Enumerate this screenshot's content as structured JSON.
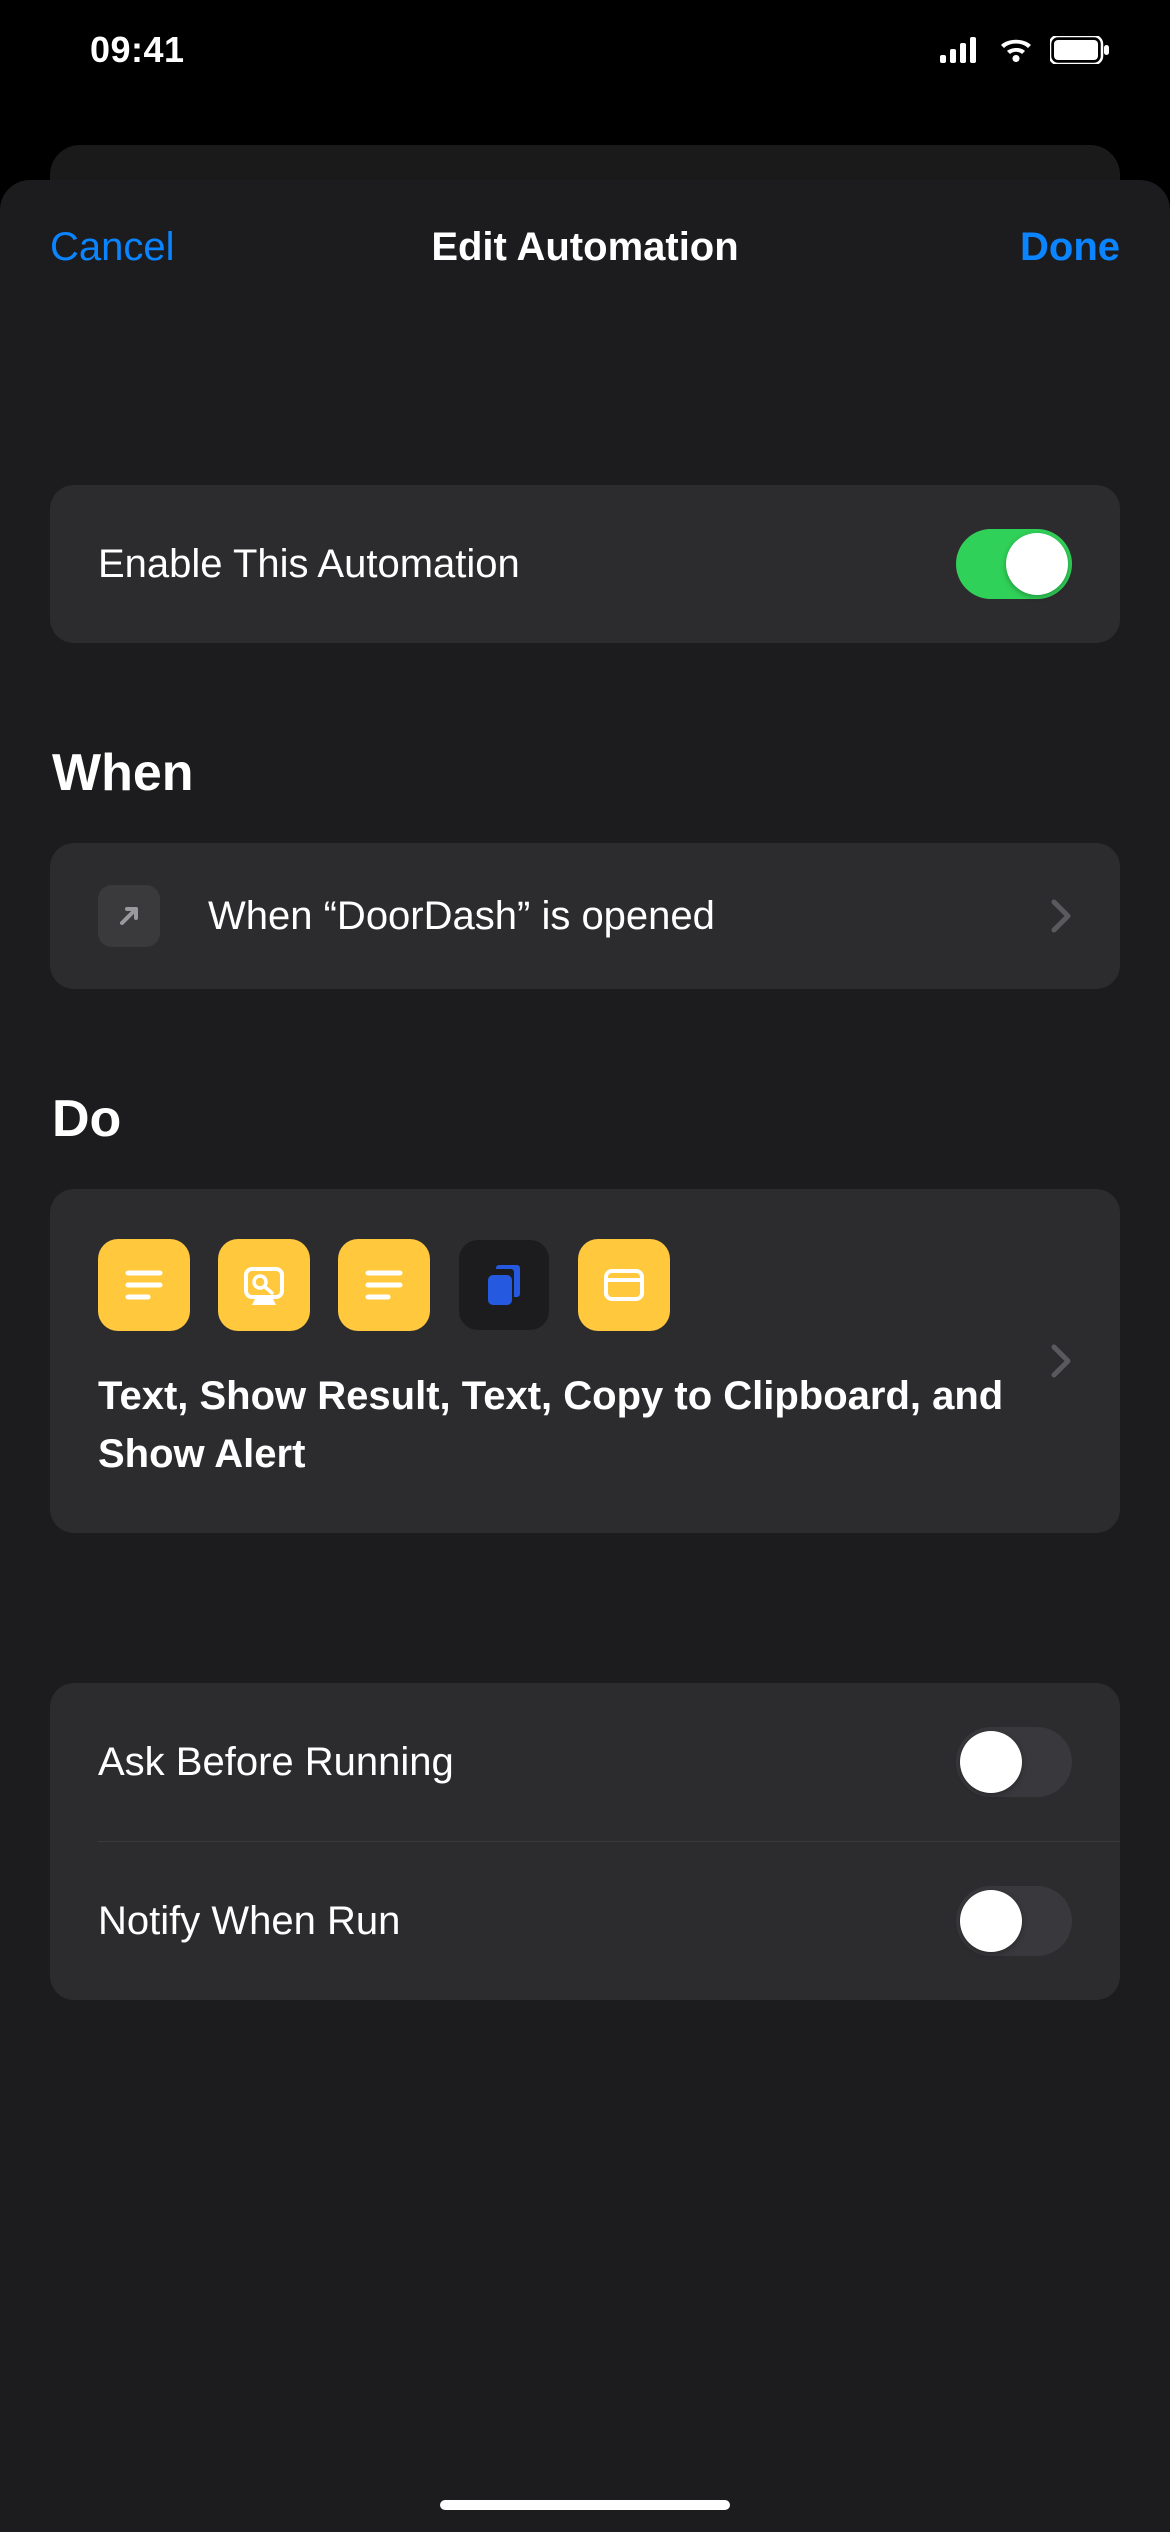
{
  "status": {
    "time": "09:41"
  },
  "nav": {
    "cancel": "Cancel",
    "title": "Edit Automation",
    "done": "Done"
  },
  "enable": {
    "label": "Enable This Automation",
    "on": true
  },
  "when": {
    "header": "When",
    "text": "When “DoorDash” is opened"
  },
  "do": {
    "header": "Do",
    "summary": "Text, Show Result, Text, Copy to Clipboard, and Show Alert",
    "actions": [
      {
        "name": "text-icon",
        "type": "text",
        "color": "yellow"
      },
      {
        "name": "show-result-icon",
        "type": "search",
        "color": "yellow"
      },
      {
        "name": "text-icon",
        "type": "text",
        "color": "yellow"
      },
      {
        "name": "copy-clipboard-icon",
        "type": "clipboard",
        "color": "dark"
      },
      {
        "name": "show-alert-icon",
        "type": "alert",
        "color": "yellow"
      }
    ]
  },
  "options": {
    "ask_label": "Ask Before Running",
    "ask_on": false,
    "notify_label": "Notify When Run",
    "notify_on": false
  }
}
